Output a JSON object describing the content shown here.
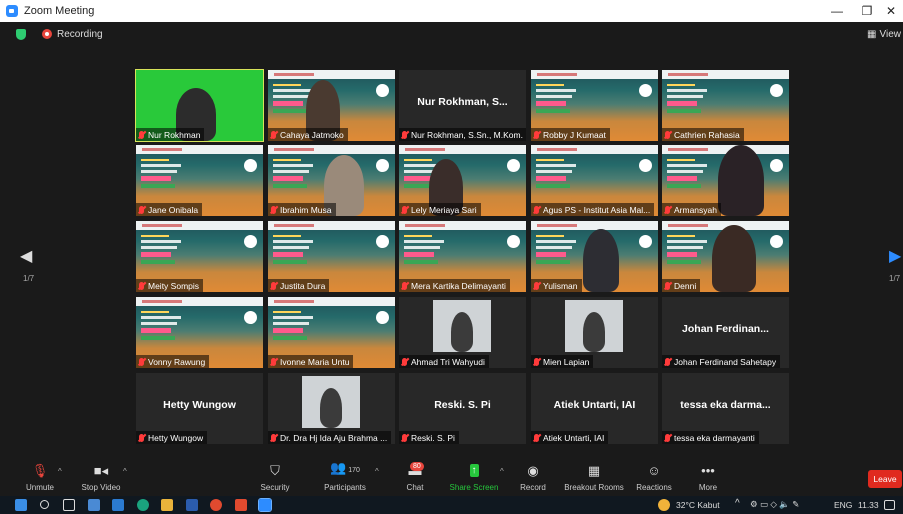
{
  "window": {
    "title": "Zoom Meeting",
    "controls": [
      "—",
      "❐",
      "✕"
    ]
  },
  "topbar": {
    "recording_label": "Recording",
    "view_label": "View"
  },
  "nav": {
    "prev_page": "1/7",
    "next_page": "1/7"
  },
  "tiles": [
    {
      "name": "Nur Rokhman",
      "type": "video-green",
      "active": true
    },
    {
      "name": "Cahaya Jatmoko",
      "type": "video-banner"
    },
    {
      "name": "Nur Rokhman, S.Sn., M.Kom.",
      "type": "name-only",
      "display": "Nur Rokhman, S..."
    },
    {
      "name": "Robby J Kumaat",
      "type": "banner"
    },
    {
      "name": "Cathrien Rahasia",
      "type": "banner"
    },
    {
      "name": "Jane Onibala",
      "type": "banner"
    },
    {
      "name": "Ibrahim Musa",
      "type": "video-banner"
    },
    {
      "name": "Lely Meriaya Sari",
      "type": "video-banner"
    },
    {
      "name": "Agus PS - Institut Asia Mal...",
      "type": "banner"
    },
    {
      "name": "Armansyah",
      "type": "video-banner"
    },
    {
      "name": "Meity Sompis",
      "type": "banner"
    },
    {
      "name": "Justita Dura",
      "type": "banner"
    },
    {
      "name": "Mera Kartika Delimayanti",
      "type": "banner"
    },
    {
      "name": "Yulisman",
      "type": "video-banner"
    },
    {
      "name": "Denni",
      "type": "video-banner"
    },
    {
      "name": "Vonny Rawung",
      "type": "banner"
    },
    {
      "name": "Ivonne Maria Untu",
      "type": "banner"
    },
    {
      "name": "Ahmad Tri Wahyudi",
      "type": "photo"
    },
    {
      "name": "Mien Lapian",
      "type": "photo"
    },
    {
      "name": "Johan Ferdinand Sahetapy",
      "type": "name-only",
      "display": "Johan Ferdinan..."
    },
    {
      "name": "Hetty Wungow",
      "type": "name-only",
      "display": "Hetty Wungow"
    },
    {
      "name": "Dr. Dra Hj Ida Aju Brahma ...",
      "type": "photo"
    },
    {
      "name": "Reski. S. Pi",
      "type": "name-only",
      "display": "Reski. S. Pi"
    },
    {
      "name": "Atiek Untarti, IAI",
      "type": "name-only",
      "display": "Atiek Untarti, IAI"
    },
    {
      "name": "tessa eka darmayanti",
      "type": "name-only",
      "display": "tessa eka darma..."
    }
  ],
  "toolbar": {
    "unmute": "Unmute",
    "stop_video": "Stop Video",
    "security": "Security",
    "participants": "Participants",
    "participants_count": "170",
    "chat": "Chat",
    "chat_badge": "80",
    "share_screen": "Share Screen",
    "record": "Record",
    "breakout": "Breakout Rooms",
    "reactions": "Reactions",
    "more": "More",
    "leave": "Leave"
  },
  "taskbar": {
    "weather": "32°C  Kabut",
    "lang": "ENG",
    "time": "11.33"
  },
  "colors": {
    "accent_green": "#26c63c",
    "leave_red": "#e02a1f",
    "active_outline": "#d7e35a"
  }
}
